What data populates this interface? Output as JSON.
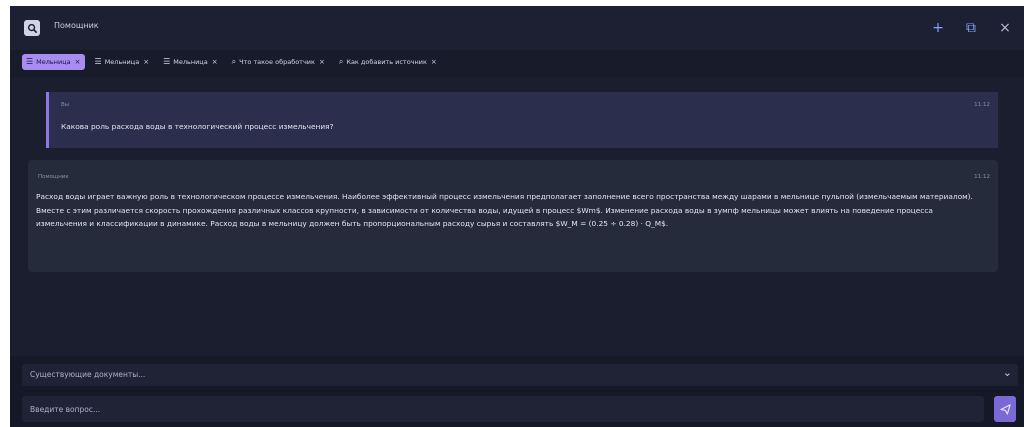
{
  "app": {
    "title": "Помощник"
  },
  "window_controls": {
    "new": "+",
    "maximize": "⧉",
    "close": "×"
  },
  "chips": [
    {
      "label": "Мельница",
      "icon": "doc-icon",
      "active": true
    },
    {
      "label": "Мельница",
      "icon": "doc-icon",
      "active": false
    },
    {
      "label": "Мельница",
      "icon": "doc-icon",
      "active": false
    },
    {
      "label": "Что такое обработчик",
      "icon": "search-icon",
      "active": false
    },
    {
      "label": "Как добавить источник",
      "icon": "search-icon",
      "active": false
    }
  ],
  "chip_close": "×",
  "messages": {
    "user": {
      "sender": "Вы",
      "time": "11:12",
      "text": "Какова роль расхода воды в технологический процесс измельчения?"
    },
    "bot": {
      "sender": "Помощник",
      "time": "11:12",
      "text": "Расход воды играет важную роль в технологическом процессе измельчения. Наиболее эффективный процесс измельчения предполагает заполнение всего пространства между шарами в мельнице пульпой (измельчаемым материалом). Вместе с этим различается скорость прохождения различных классов крупности, в зависимости от количества воды, идущей в процесс $Wm$. Изменение расхода воды в зумпф мельницы может влиять на поведение процесса измельчения и классификации в динамике. Расход воды в мельницу должен быть пропорциональным расходу сырья и составлять $W_M = (0.25 ÷ 0.28) · Q_M$."
    }
  },
  "documents_select": {
    "label": "Существующие документы..."
  },
  "question_input": {
    "placeholder": "Введите вопрос...",
    "value": ""
  },
  "colors": {
    "background": "#171b2a",
    "accent": "#a88cf2",
    "send": "#7b6ad6",
    "user_bubble": "#2b2e4d",
    "bot_bubble": "#262b3b"
  }
}
